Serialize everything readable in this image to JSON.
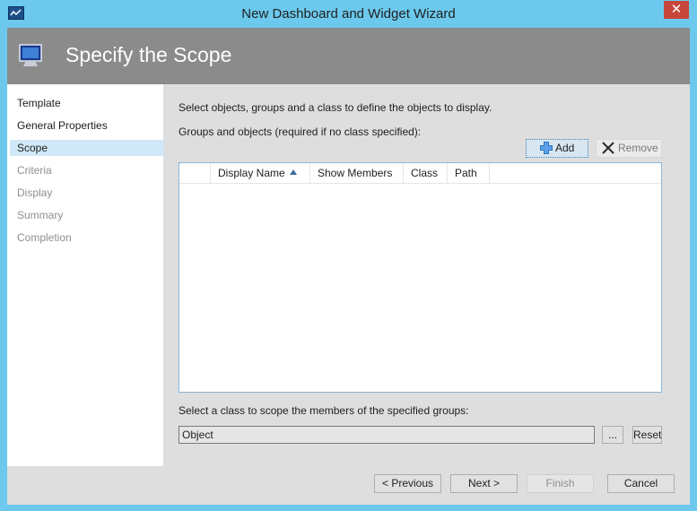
{
  "window": {
    "title": "New Dashboard and Widget Wizard",
    "close_glyph": "✕"
  },
  "banner": {
    "title": "Specify the Scope",
    "icon": "monitor-icon"
  },
  "nav": {
    "items": [
      {
        "label": "Template",
        "state": "normal"
      },
      {
        "label": "General Properties",
        "state": "normal"
      },
      {
        "label": "Scope",
        "state": "active"
      },
      {
        "label": "Criteria",
        "state": "disabled"
      },
      {
        "label": "Display",
        "state": "disabled"
      },
      {
        "label": "Summary",
        "state": "disabled"
      },
      {
        "label": "Completion",
        "state": "disabled"
      }
    ]
  },
  "main": {
    "instruction": "Select objects, groups and a class to define the objects to display.",
    "groups_label": "Groups and objects (required if no class specified):",
    "add_label": "Add",
    "remove_label": "Remove",
    "columns": [
      "Display Name",
      "Show Members",
      "Class",
      "Path"
    ],
    "class_label": "Select a class to scope the members of the specified groups:",
    "class_value": "Object",
    "browse_label": "...",
    "reset_label": "Reset"
  },
  "footer": {
    "previous_label": "< Previous",
    "next_label": "Next >",
    "finish_label": "Finish",
    "cancel_label": "Cancel"
  },
  "colors": {
    "frame": "#6cc9ed",
    "banner": "#8b8b8b",
    "close": "#c7463b",
    "active_nav": "#d1e8f8"
  }
}
